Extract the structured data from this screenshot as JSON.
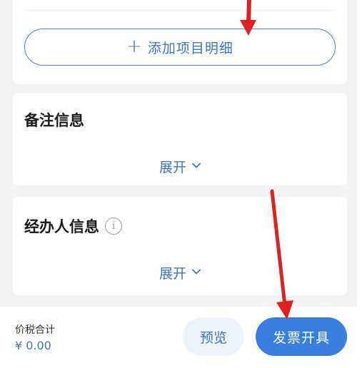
{
  "items_section": {
    "add_button_label": "添加项目明细"
  },
  "remarks_section": {
    "title": "备注信息",
    "expand_label": "展开"
  },
  "agent_section": {
    "title": "经办人信息",
    "info_glyph": "i",
    "expand_label": "展开"
  },
  "footer": {
    "total_label": "价税合计",
    "total_value": "¥ 0.00",
    "preview_label": "预览",
    "issue_label": "发票开具"
  },
  "colors": {
    "accent": "#3a7fe0",
    "text_link": "#3f73c4",
    "annotation_arrow": "#e02020"
  }
}
